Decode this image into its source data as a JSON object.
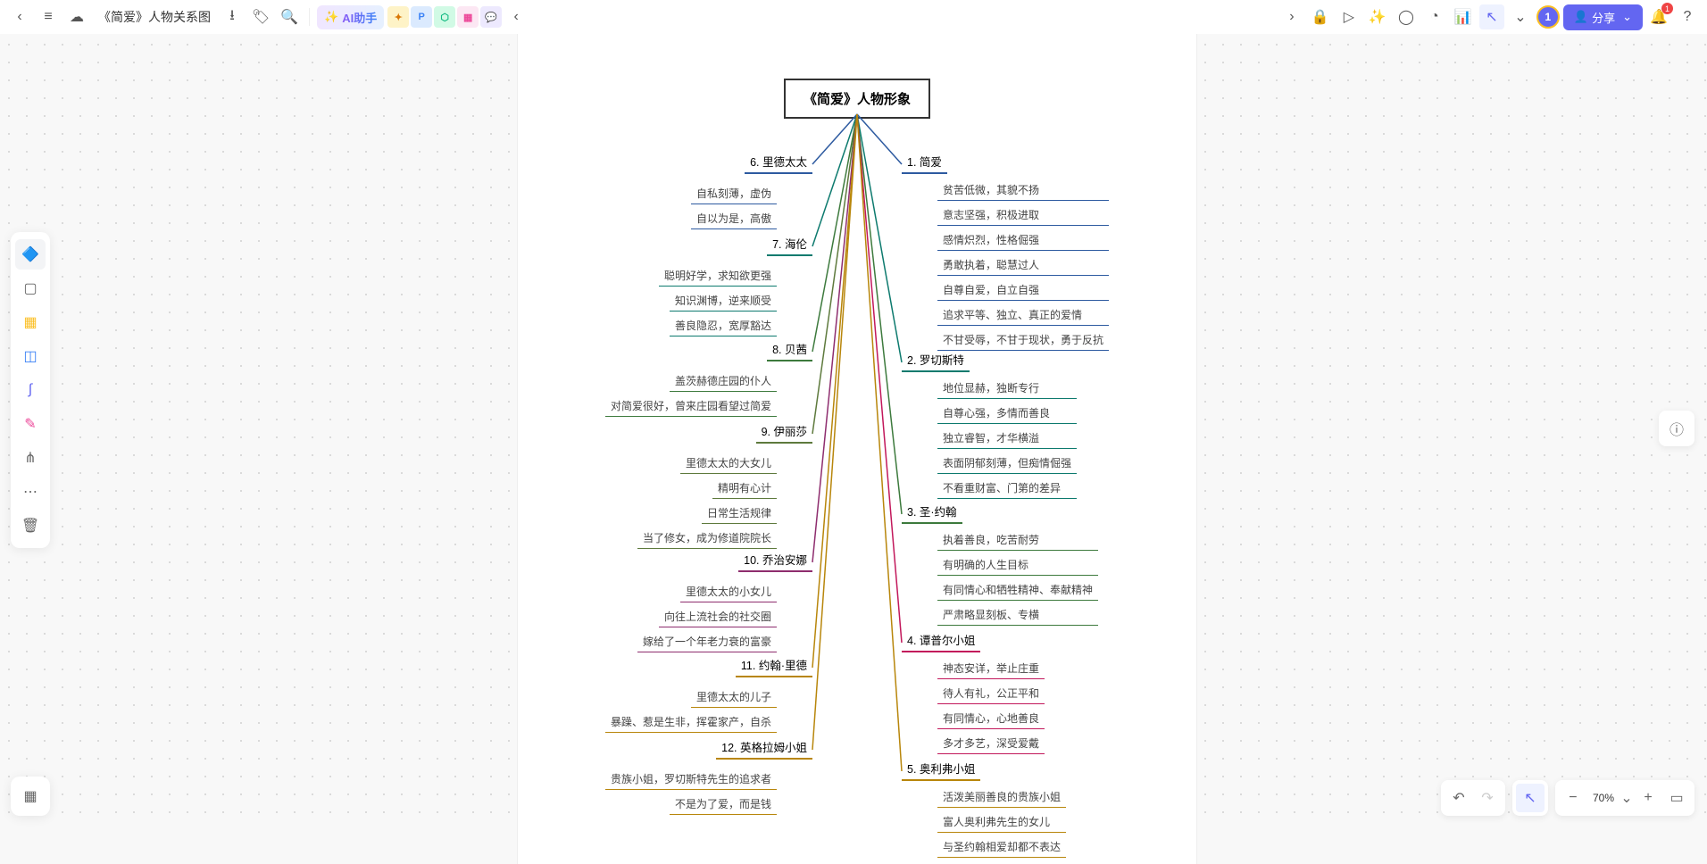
{
  "doc_title": "《简爱》人物关系图",
  "ai_label": "AI助手",
  "share_label": "分享",
  "avatar": "1",
  "notif_count": "1",
  "zoom": "70%",
  "mindmap": {
    "root": "《简爱》人物形象",
    "right": [
      {
        "title": "1. 简爱",
        "color": "#2d5aa0",
        "items": [
          "贫苦低微，其貌不扬",
          "意志坚强，积极进取",
          "感情炽烈，性格倔强",
          "勇敢执着，聪慧过人",
          "自尊自爱，自立自强",
          "追求平等、独立、真正的爱情",
          "不甘受辱，不甘于现状，勇于反抗"
        ]
      },
      {
        "title": "2. 罗切斯特",
        "color": "#0d7a6e",
        "items": [
          "地位显赫，独断专行",
          "自尊心强，多情而善良",
          "独立睿智，才华横溢",
          "表面阴郁刻薄，但痴情倔强",
          "不看重财富、门第的差异"
        ]
      },
      {
        "title": "3. 圣·约翰",
        "color": "#3d7a3d",
        "items": [
          "执着善良，吃苦耐劳",
          "有明确的人生目标",
          "有同情心和牺牲精神、奉献精神",
          "严肃略显刻板、专横"
        ]
      },
      {
        "title": "4. 谭普尔小姐",
        "color": "#c2185b",
        "items": [
          "神态安详，举止庄重",
          "待人有礼，公正平和",
          "有同情心，心地善良",
          "多才多艺，深受爱戴"
        ]
      },
      {
        "title": "5. 奥利弗小姐",
        "color": "#b8860b",
        "items": [
          "活泼美丽善良的贵族小姐",
          "富人奥利弗先生的女儿",
          "与圣约翰相爱却都不表达"
        ]
      }
    ],
    "left": [
      {
        "title": "6. 里德太太",
        "color": "#2d5aa0",
        "items": [
          "自私刻薄，虚伪",
          "自以为是，高傲"
        ]
      },
      {
        "title": "7. 海伦",
        "color": "#0d7a6e",
        "items": [
          "聪明好学，求知欲更强",
          "知识渊博，逆来顺受",
          "善良隐忍，宽厚豁达"
        ]
      },
      {
        "title": "8. 贝茜",
        "color": "#3d7a3d",
        "items": [
          "盖茨赫德庄园的仆人",
          "对简爱很好，曾来庄园看望过简爱"
        ]
      },
      {
        "title": "9. 伊丽莎",
        "color": "#5e7a3d",
        "items": [
          "里德太太的大女儿",
          "精明有心计",
          "日常生活规律",
          "当了修女，成为修道院院长"
        ]
      },
      {
        "title": "10. 乔治安娜",
        "color": "#8e2d6e",
        "items": [
          "里德太太的小女儿",
          "向往上流社会的社交圈",
          "嫁给了一个年老力衰的富豪"
        ]
      },
      {
        "title": "11. 约翰·里德",
        "color": "#b8860b",
        "items": [
          "里德太太的儿子",
          "暴躁、惹是生非，挥霍家产，自杀"
        ]
      },
      {
        "title": "12. 英格拉姆小姐",
        "color": "#b8860b",
        "items": [
          "贵族小姐，罗切斯特先生的追求者",
          "不是为了爱，而是钱"
        ]
      }
    ]
  }
}
